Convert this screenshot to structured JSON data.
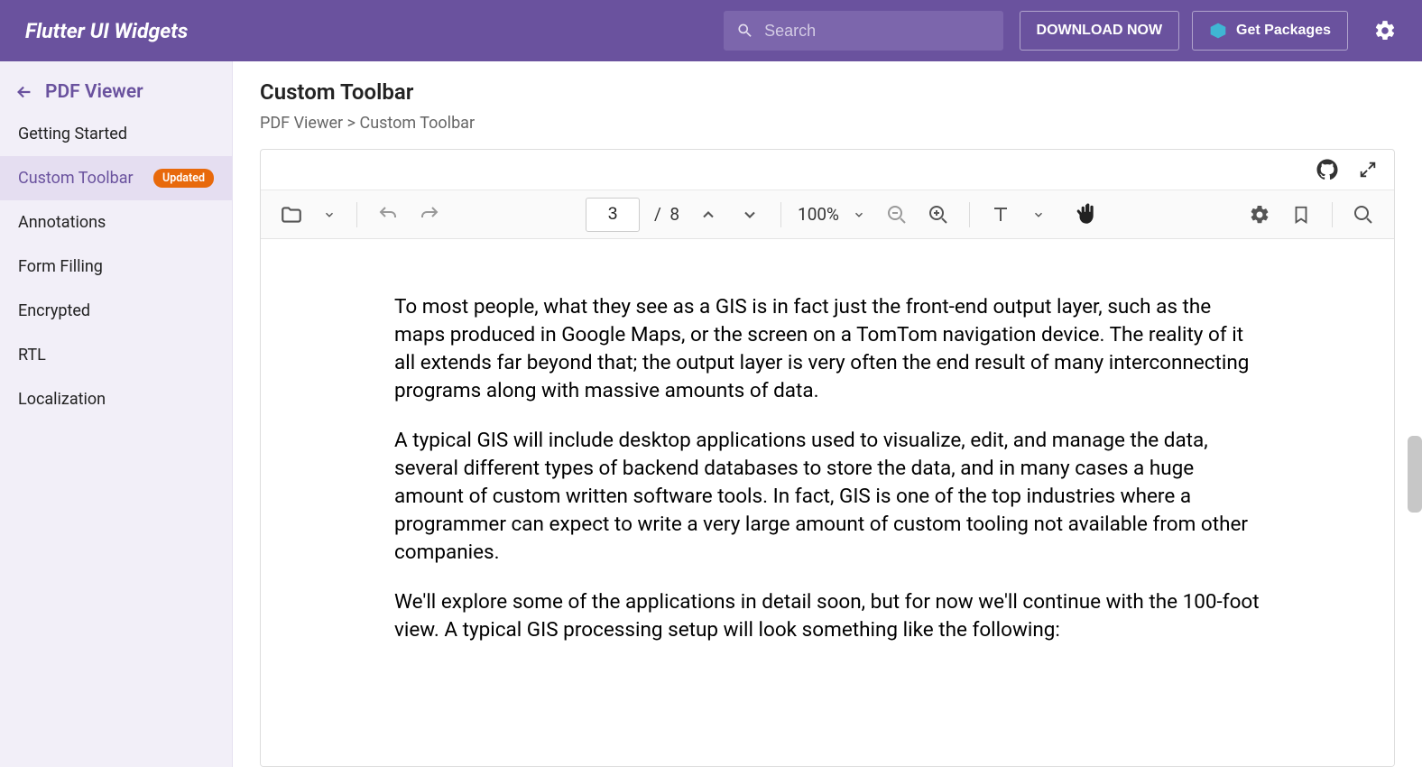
{
  "brand": "Flutter UI Widgets",
  "search": {
    "placeholder": "Search"
  },
  "header_buttons": {
    "download": "DOWNLOAD NOW",
    "get_packages": "Get Packages"
  },
  "sidebar": {
    "title": "PDF Viewer",
    "items": [
      {
        "label": "Getting Started",
        "active": false
      },
      {
        "label": "Custom Toolbar",
        "active": true,
        "badge": "Updated"
      },
      {
        "label": "Annotations",
        "active": false
      },
      {
        "label": "Form Filling",
        "active": false
      },
      {
        "label": "Encrypted",
        "active": false
      },
      {
        "label": "RTL",
        "active": false
      },
      {
        "label": "Localization",
        "active": false
      }
    ]
  },
  "page": {
    "title": "Custom Toolbar",
    "breadcrumb": "PDF Viewer > Custom Toolbar"
  },
  "pdf_toolbar": {
    "current_page": "3",
    "page_sep": "/",
    "total_pages": "8",
    "zoom": "100%"
  },
  "document": {
    "paragraphs": [
      "To most people, what they see as a GIS is in fact just the front-end output layer, such as the maps produced in Google Maps, or the screen on a TomTom navigation device. The reality of it all extends far beyond that; the output layer is very often the end result of many interconnecting programs along with massive amounts of data.",
      "A typical GIS will include desktop applications used to visualize, edit, and manage the data, several different types of backend databases to store the data, and in many cases a huge amount of custom written software tools. In fact, GIS is one of the top industries where a programmer can expect to write a very large amount of custom tooling not available from other companies.",
      "We'll explore some of the applications in detail soon, but for now we'll continue with the 100-foot view. A typical GIS processing setup will look something like the following:"
    ]
  }
}
